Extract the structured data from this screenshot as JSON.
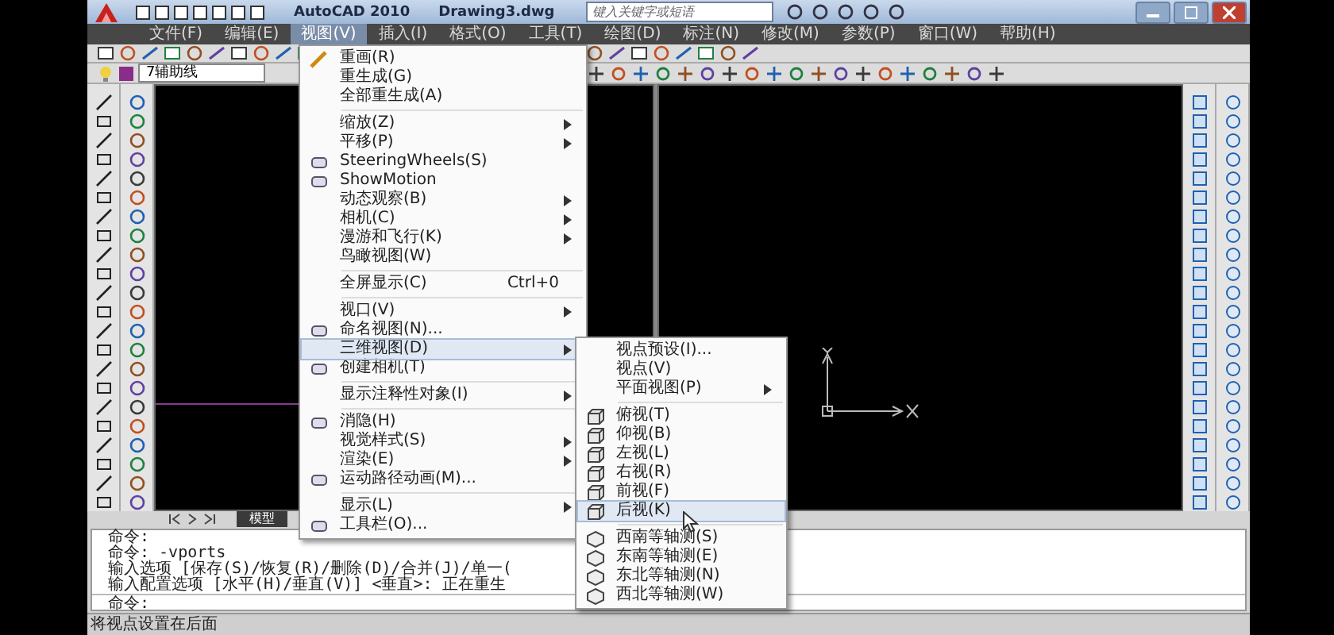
{
  "title_bar": {
    "app": "AutoCAD 2010",
    "file": "Drawing3.dwg",
    "search": {
      "placeholder": "键入关键字或短语"
    }
  },
  "menu_bar": [
    {
      "label": "文件(F)",
      "selected": false
    },
    {
      "label": "编辑(E)",
      "selected": false
    },
    {
      "label": "视图(V)",
      "selected": true
    },
    {
      "label": "插入(I)",
      "selected": false
    },
    {
      "label": "格式(O)",
      "selected": false
    },
    {
      "label": "工具(T)",
      "selected": false
    },
    {
      "label": "绘图(D)",
      "selected": false
    },
    {
      "label": "标注(N)",
      "selected": false
    },
    {
      "label": "修改(M)",
      "selected": false
    },
    {
      "label": "参数(P)",
      "selected": false
    },
    {
      "label": "窗口(W)",
      "selected": false
    },
    {
      "label": "帮助(H)",
      "selected": false
    }
  ],
  "layer": {
    "name": "7辅助线"
  },
  "layout_tabs": [
    {
      "label": "模型",
      "selected": true
    }
  ],
  "command": {
    "history": [
      "命令:",
      "命令:  -vports",
      "输入选项 [保存(S)/恢复(R)/删除(D)/合并(J)/单一(",
      "输入配置选项 [水平(H)/垂直(V)] <垂直>:  正在重生"
    ],
    "prompt": "命令:"
  },
  "status_bar": {
    "text": "将视点设置在后面"
  },
  "view_menu": {
    "items": [
      {
        "kind": "item",
        "label": "重画(R)",
        "submenu": false,
        "selected": false
      },
      {
        "kind": "item",
        "label": "重生成(G)",
        "submenu": false,
        "selected": false
      },
      {
        "kind": "item",
        "label": "全部重生成(A)",
        "submenu": false,
        "selected": false
      },
      {
        "kind": "separator"
      },
      {
        "kind": "item",
        "label": "缩放(Z)",
        "submenu": true,
        "selected": false
      },
      {
        "kind": "item",
        "label": "平移(P)",
        "submenu": true,
        "selected": false
      },
      {
        "kind": "item",
        "label": "SteeringWheels(S)",
        "submenu": false,
        "selected": false
      },
      {
        "kind": "item",
        "label": "ShowMotion",
        "submenu": false,
        "selected": false
      },
      {
        "kind": "item",
        "label": "动态观察(B)",
        "submenu": true,
        "selected": false
      },
      {
        "kind": "item",
        "label": "相机(C)",
        "submenu": true,
        "selected": false
      },
      {
        "kind": "item",
        "label": "漫游和飞行(K)",
        "submenu": true,
        "selected": false
      },
      {
        "kind": "item",
        "label": "鸟瞰视图(W)",
        "submenu": false,
        "selected": false
      },
      {
        "kind": "separator"
      },
      {
        "kind": "item",
        "label": "全屏显示(C)",
        "shortcut": "Ctrl+0",
        "submenu": false,
        "selected": false
      },
      {
        "kind": "separator"
      },
      {
        "kind": "item",
        "label": "视口(V)",
        "submenu": true,
        "selected": false
      },
      {
        "kind": "item",
        "label": "命名视图(N)...",
        "submenu": false,
        "selected": false
      },
      {
        "kind": "item",
        "label": "三维视图(D)",
        "submenu": true,
        "selected": true
      },
      {
        "kind": "item",
        "label": "创建相机(T)",
        "submenu": false,
        "selected": false
      },
      {
        "kind": "separator"
      },
      {
        "kind": "item",
        "label": "显示注释性对象(I)",
        "submenu": true,
        "selected": false
      },
      {
        "kind": "separator"
      },
      {
        "kind": "item",
        "label": "消隐(H)",
        "submenu": false,
        "selected": false
      },
      {
        "kind": "item",
        "label": "视觉样式(S)",
        "submenu": true,
        "selected": false
      },
      {
        "kind": "item",
        "label": "渲染(E)",
        "submenu": true,
        "selected": false
      },
      {
        "kind": "item",
        "label": "运动路径动画(M)...",
        "submenu": false,
        "selected": false
      },
      {
        "kind": "separator"
      },
      {
        "kind": "item",
        "label": "显示(L)",
        "submenu": true,
        "selected": false
      },
      {
        "kind": "item",
        "label": "工具栏(O)...",
        "submenu": false,
        "selected": false
      }
    ]
  },
  "view_3d_submenu": {
    "items": [
      {
        "kind": "item",
        "label": "视点预设(I)...",
        "submenu": false,
        "selected": false
      },
      {
        "kind": "item",
        "label": "视点(V)",
        "submenu": false,
        "selected": false
      },
      {
        "kind": "item",
        "label": "平面视图(P)",
        "submenu": true,
        "selected": false
      },
      {
        "kind": "separator"
      },
      {
        "kind": "item",
        "label": "俯视(T)",
        "submenu": false,
        "selected": false
      },
      {
        "kind": "item",
        "label": "仰视(B)",
        "submenu": false,
        "selected": false
      },
      {
        "kind": "item",
        "label": "左视(L)",
        "submenu": false,
        "selected": false
      },
      {
        "kind": "item",
        "label": "右视(R)",
        "submenu": false,
        "selected": false
      },
      {
        "kind": "item",
        "label": "前视(F)",
        "submenu": false,
        "selected": false
      },
      {
        "kind": "item",
        "label": "后视(K)",
        "submenu": false,
        "selected": true
      },
      {
        "kind": "separator"
      },
      {
        "kind": "item",
        "label": "西南等轴测(S)",
        "submenu": false,
        "selected": false
      },
      {
        "kind": "item",
        "label": "东南等轴测(E)",
        "submenu": false,
        "selected": false
      },
      {
        "kind": "item",
        "label": "东北等轴测(N)",
        "submenu": false,
        "selected": false
      },
      {
        "kind": "item",
        "label": "西北等轴测(W)",
        "submenu": false,
        "selected": false
      }
    ]
  }
}
